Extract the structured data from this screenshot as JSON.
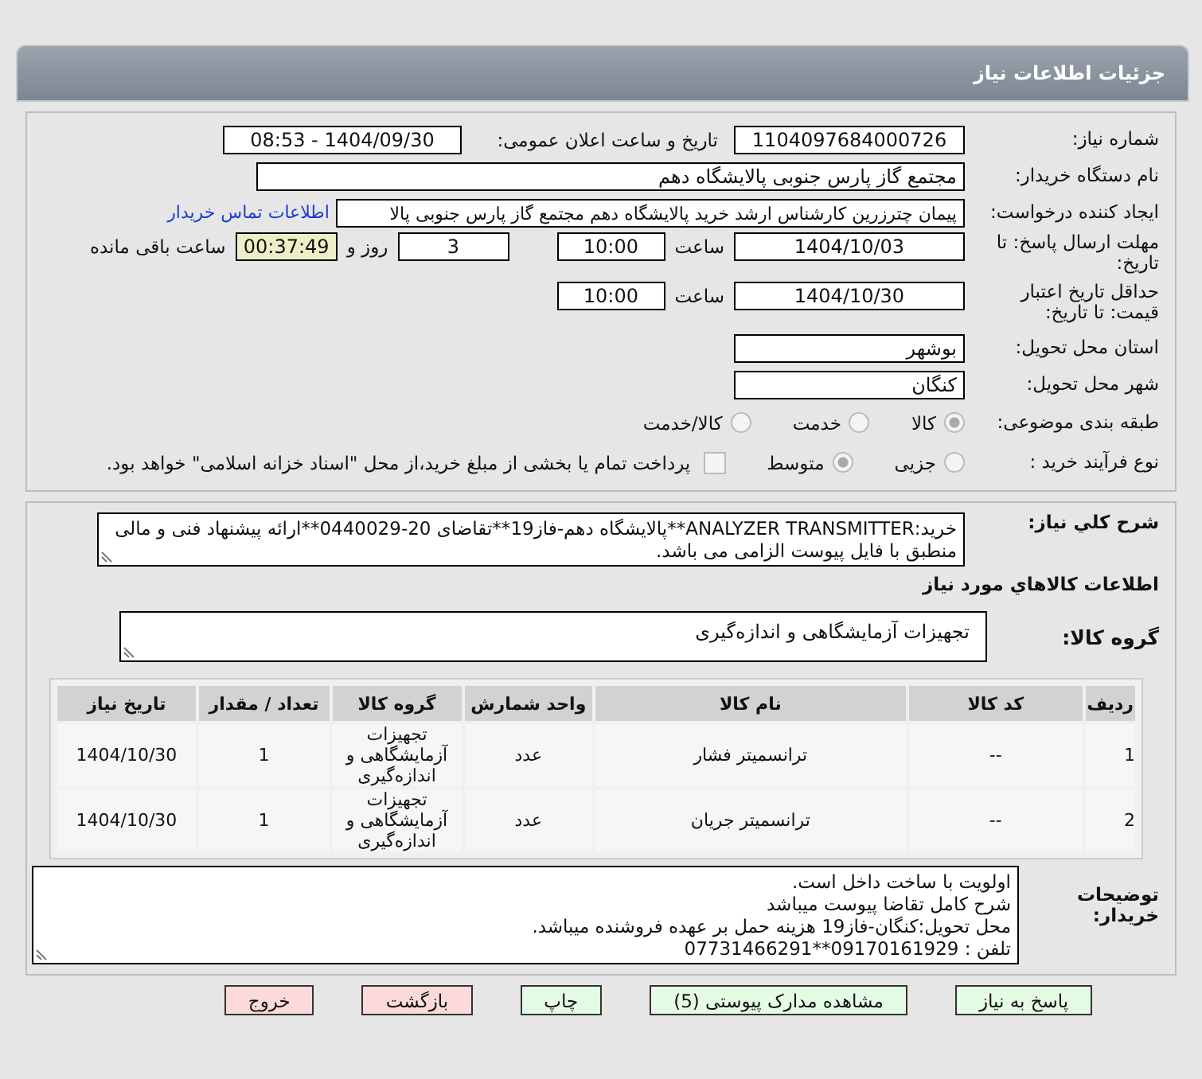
{
  "header": {
    "title": "جزئیات اطلاعات نیاز"
  },
  "info": {
    "need_number": {
      "label": "شماره نیاز:",
      "value": "1104097684000726"
    },
    "announce": {
      "label": "تاریخ و ساعت اعلان عمومی:",
      "value": "1404/09/30 - 08:53"
    },
    "buyer_org": {
      "label": "نام دستگاه خریدار:",
      "value": "مجتمع گاز پارس جنوبی  پالایشگاه دهم"
    },
    "requester": {
      "label": "ایجاد کننده درخواست:",
      "value": "پیمان چترزرین کارشناس ارشد خرید پالایشگاه دهم مجتمع گاز پارس جنوبی  پالا",
      "link": "اطلاعات تماس خریدار"
    },
    "deadline": {
      "label": "مهلت ارسال پاسخ: تا تاریخ:",
      "date": "1404/10/03",
      "time_label": "ساعت",
      "time": "10:00",
      "days": "3",
      "days_label": "روز و",
      "remaining": "00:37:49",
      "remaining_label": "ساعت باقی مانده"
    },
    "validity": {
      "label": "حداقل تاریخ اعتبار قیمت: تا تاریخ:",
      "date": "1404/10/30",
      "time_label": "ساعت",
      "time": "10:00"
    },
    "province": {
      "label": "استان محل تحویل:",
      "value": "بوشهر"
    },
    "city": {
      "label": "شهر محل تحویل:",
      "value": "کنگان"
    },
    "category": {
      "label": "طبقه بندی موضوعی:",
      "options": [
        {
          "label": "کالا",
          "selected": true
        },
        {
          "label": "خدمت",
          "selected": false
        },
        {
          "label": "کالا/خدمت",
          "selected": false
        }
      ]
    },
    "process": {
      "label": "نوع فرآیند خرید :",
      "options": [
        {
          "label": "جزیی",
          "selected": false
        },
        {
          "label": "متوسط",
          "selected": true
        }
      ],
      "checkbox": {
        "label": "پرداخت تمام یا بخشی از مبلغ خرید،از محل \"اسناد خزانه اسلامی\" خواهد بود.",
        "checked": false
      }
    }
  },
  "details": {
    "description": {
      "label": "شرح كلي نياز:",
      "value": "خرید:ANALYZER TRANSMITTER**پالایشگاه دهم-فاز19**تقاضای 20-0440029**ارائه پیشنهاد فنی و مالی منطبق با فایل پیوست الزامی می باشد."
    },
    "goods_title": "اطلاعات كالاهاي مورد نياز",
    "goods_group": {
      "label": "گروه کالا:",
      "value": "تجهیزات آزمایشگاهی و اندازه‌گیری"
    },
    "table": {
      "columns": [
        "ردیف",
        "کد کالا",
        "نام کالا",
        "واحد شمارش",
        "گروه کالا",
        "تعداد / مقدار",
        "تاریخ نیاز"
      ],
      "rows": [
        [
          "1",
          "--",
          "ترانسمیتر فشار",
          "عدد",
          "تجهیزات آزمایشگاهی و اندازه‌گیری",
          "1",
          "1404/10/30"
        ],
        [
          "2",
          "--",
          "ترانسمیتر جریان",
          "عدد",
          "تجهیزات آزمایشگاهی و اندازه‌گیری",
          "1",
          "1404/10/30"
        ]
      ]
    },
    "notes": {
      "label": "توضیحات خریدار:",
      "lines": [
        "اولویت با ساخت داخل است.",
        "شرح کامل تقاضا پیوست میباشد",
        "محل تحویل:کنگان-فاز19 هزینه حمل بر عهده فروشنده میباشد.",
        "تلفن : 09170161929**07731466291"
      ]
    }
  },
  "buttons": [
    {
      "label": "پاسخ به نیاز",
      "kind": "primary"
    },
    {
      "label": "مشاهده مدارک پیوستی (5)",
      "kind": "primary"
    },
    {
      "label": "چاپ",
      "kind": "primary"
    },
    {
      "label": "بازگشت",
      "kind": "danger"
    },
    {
      "label": "خروج",
      "kind": "danger"
    }
  ]
}
